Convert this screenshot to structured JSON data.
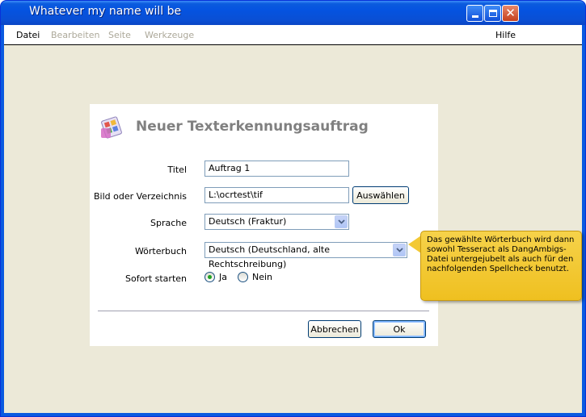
{
  "window": {
    "title": "Whatever my name will be"
  },
  "menubar": {
    "items": [
      {
        "label": "Datei",
        "enabled": true
      },
      {
        "label": "Bearbeiten",
        "enabled": false
      },
      {
        "label": "Seite",
        "enabled": false
      },
      {
        "label": "Werkzeuge",
        "enabled": false
      }
    ],
    "help": "Hilfe"
  },
  "dialog": {
    "title": "Neuer Texterkennungsauftrag",
    "fields": {
      "title": {
        "label": "Titel",
        "value": "Auftrag 1"
      },
      "path": {
        "label": "Bild oder Verzeichnis",
        "value": "L:\\ocrtest\\tif",
        "browse_label": "Auswählen"
      },
      "language": {
        "label": "Sprache",
        "value": "Deutsch (Fraktur)"
      },
      "dictionary": {
        "label": "Wörterbuch",
        "value": "Deutsch (Deutschland, alte Rechtschreibung)"
      },
      "start": {
        "label": "Sofort starten",
        "yes": "Ja",
        "no": "Nein",
        "selected": "Ja"
      }
    },
    "buttons": {
      "cancel": "Abbrechen",
      "ok": "Ok"
    }
  },
  "tooltip": {
    "text": "Das gewählte Wörterbuch wird dann sowohl Tesseract als DangAmbigs-Datei untergejubelt als auch für den nachfolgenden Spellcheck benutzt."
  },
  "colors": {
    "titlebar": "#0553e0",
    "client_bg": "#ece9d8",
    "tooltip_bg": "#f3c934",
    "radio_selected": "#21a121"
  }
}
